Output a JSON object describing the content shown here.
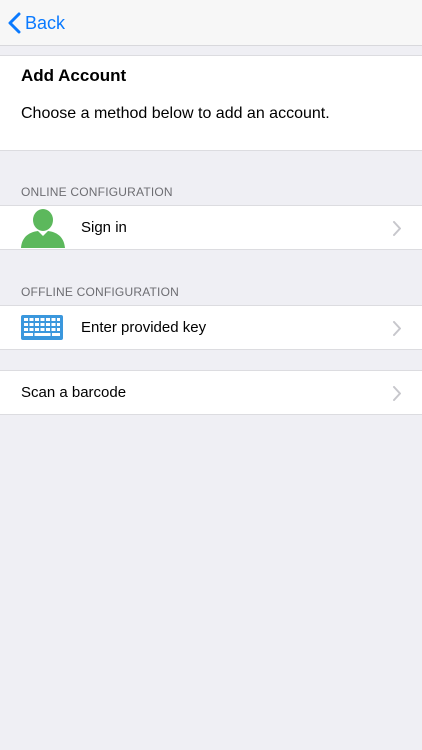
{
  "nav": {
    "back_label": "Back"
  },
  "intro": {
    "title": "Add Account",
    "description": "Choose a method below to add an account."
  },
  "sections": {
    "online": {
      "header": "ONLINE CONFIGURATION",
      "items": [
        {
          "label": "Sign in",
          "icon": "user-silhouette-icon"
        }
      ]
    },
    "offline": {
      "header": "OFFLINE CONFIGURATION",
      "items": [
        {
          "label": "Enter provided key",
          "icon": "keyboard-icon"
        }
      ]
    },
    "other": {
      "items": [
        {
          "label": "Scan a barcode"
        }
      ]
    }
  },
  "colors": {
    "accent": "#0a7aff",
    "user_icon": "#5cb85c",
    "keyboard_icon": "#3a97dd",
    "background": "#efeff4"
  }
}
